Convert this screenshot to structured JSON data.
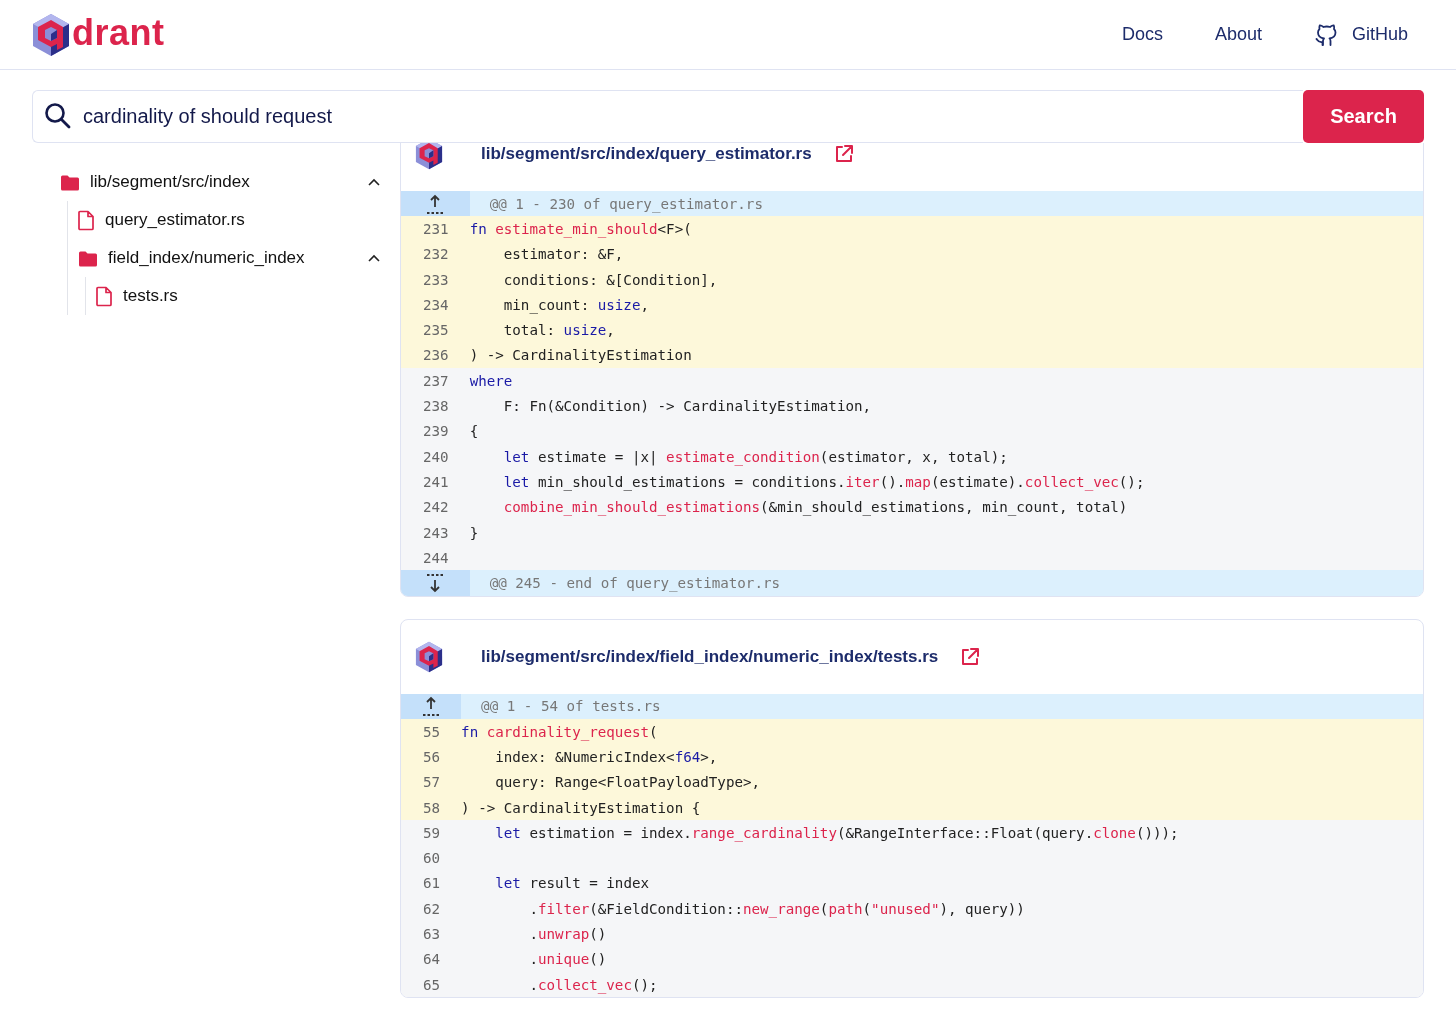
{
  "header": {
    "brand": "drant",
    "nav": [
      {
        "label": "Docs",
        "kind": "text"
      },
      {
        "label": "About",
        "kind": "text"
      },
      {
        "label": "GitHub",
        "kind": "github"
      }
    ]
  },
  "search": {
    "value": "cardinality of should request",
    "button": "Search"
  },
  "tree": [
    {
      "kind": "folder",
      "label": "lib/segment/src/index",
      "expanded": true,
      "children": [
        {
          "kind": "file",
          "label": "query_estimator.rs"
        },
        {
          "kind": "folder",
          "label": "field_index/numeric_index",
          "expanded": true,
          "children": [
            {
              "kind": "file",
              "label": "tests.rs"
            }
          ]
        }
      ]
    }
  ],
  "results": [
    {
      "path": "lib/segment/src/index/query_estimator.rs",
      "hunks": [
        {
          "kind": "expand_up",
          "text": "@@ 1 - 230 of query_estimator.rs"
        }
      ],
      "lines": [
        {
          "number": "231",
          "highlighted": true,
          "tokens": [
            {
              "kind": "keyword",
              "text": "fn"
            },
            {
              "kind": "function",
              "text": " estimate_min_should"
            },
            {
              "kind": "plain",
              "text": "<F>("
            }
          ]
        },
        {
          "number": "232",
          "highlighted": true,
          "tokens": [
            {
              "kind": "plain",
              "text": "    estimator: &F,"
            }
          ]
        },
        {
          "number": "233",
          "highlighted": true,
          "tokens": [
            {
              "kind": "plain",
              "text": "    conditions: &[Condition],"
            }
          ]
        },
        {
          "number": "234",
          "highlighted": true,
          "tokens": [
            {
              "kind": "plain",
              "text": "    min_count: "
            },
            {
              "kind": "keyword",
              "text": "usize"
            },
            {
              "kind": "plain",
              "text": ","
            }
          ]
        },
        {
          "number": "235",
          "highlighted": true,
          "tokens": [
            {
              "kind": "plain",
              "text": "    total: "
            },
            {
              "kind": "keyword",
              "text": "usize"
            },
            {
              "kind": "plain",
              "text": ","
            }
          ]
        },
        {
          "number": "236",
          "highlighted": true,
          "tokens": [
            {
              "kind": "plain",
              "text": ") -> CardinalityEstimation"
            }
          ]
        },
        {
          "number": "237",
          "highlighted": false,
          "tokens": [
            {
              "kind": "keyword",
              "text": "where"
            }
          ]
        },
        {
          "number": "238",
          "highlighted": false,
          "tokens": [
            {
              "kind": "plain",
              "text": "    F: Fn(&Condition) -> CardinalityEstimation,"
            }
          ]
        },
        {
          "number": "239",
          "highlighted": false,
          "tokens": [
            {
              "kind": "plain",
              "text": "{"
            }
          ]
        },
        {
          "number": "240",
          "highlighted": false,
          "tokens": [
            {
              "kind": "keyword",
              "text": "    let"
            },
            {
              "kind": "plain",
              "text": " estimate = |x| "
            },
            {
              "kind": "function",
              "text": "estimate_condition"
            },
            {
              "kind": "plain",
              "text": "(estimator, x, total);"
            }
          ]
        },
        {
          "number": "241",
          "highlighted": false,
          "tokens": [
            {
              "kind": "keyword",
              "text": "    let"
            },
            {
              "kind": "plain",
              "text": " min_should_estimations = conditions."
            },
            {
              "kind": "function",
              "text": "iter"
            },
            {
              "kind": "plain",
              "text": "()."
            },
            {
              "kind": "function",
              "text": "map"
            },
            {
              "kind": "plain",
              "text": "(estimate)."
            },
            {
              "kind": "function",
              "text": "collect_vec"
            },
            {
              "kind": "plain",
              "text": "();"
            }
          ]
        },
        {
          "number": "242",
          "highlighted": false,
          "tokens": [
            {
              "kind": "function",
              "text": "    combine_min_should_estimations"
            },
            {
              "kind": "plain",
              "text": "(&min_should_estimations, min_count, total)"
            }
          ]
        },
        {
          "number": "243",
          "highlighted": false,
          "tokens": [
            {
              "kind": "plain",
              "text": "}"
            }
          ]
        },
        {
          "number": "244",
          "highlighted": false
        }
      ],
      "hunks_after": [
        {
          "kind": "expand_down",
          "text": "@@ 245 - end of query_estimator.rs"
        }
      ]
    },
    {
      "path": "lib/segment/src/index/field_index/numeric_index/tests.rs",
      "hunks": [
        {
          "kind": "expand_up",
          "text": "@@ 1 - 54 of tests.rs"
        }
      ],
      "lines": [
        {
          "number": "55",
          "highlighted": true,
          "tokens": [
            {
              "kind": "keyword",
              "text": "fn"
            },
            {
              "kind": "function",
              "text": " cardinality_request"
            },
            {
              "kind": "plain",
              "text": "("
            }
          ]
        },
        {
          "number": "56",
          "highlighted": true,
          "tokens": [
            {
              "kind": "plain",
              "text": "    index: &NumericIndex<"
            },
            {
              "kind": "keyword",
              "text": "f64"
            },
            {
              "kind": "plain",
              "text": ">,"
            }
          ]
        },
        {
          "number": "57",
          "highlighted": true,
          "tokens": [
            {
              "kind": "plain",
              "text": "    query: Range<FloatPayloadType>,"
            }
          ]
        },
        {
          "number": "58",
          "highlighted": true,
          "tokens": [
            {
              "kind": "plain",
              "text": ") -> CardinalityEstimation {"
            }
          ]
        },
        {
          "number": "59",
          "highlighted": false,
          "tokens": [
            {
              "kind": "keyword",
              "text": "    let"
            },
            {
              "kind": "plain",
              "text": " estimation = index."
            },
            {
              "kind": "function",
              "text": "range_cardinality"
            },
            {
              "kind": "plain",
              "text": "(&RangeInterface::Float(query."
            },
            {
              "kind": "function",
              "text": "clone"
            },
            {
              "kind": "plain",
              "text": "()));"
            }
          ]
        },
        {
          "number": "60",
          "highlighted": false
        },
        {
          "number": "61",
          "highlighted": false,
          "tokens": [
            {
              "kind": "keyword",
              "text": "    let"
            },
            {
              "kind": "plain",
              "text": " result = index"
            }
          ]
        },
        {
          "number": "62",
          "highlighted": false,
          "tokens": [
            {
              "kind": "plain",
              "text": "        ."
            },
            {
              "kind": "function",
              "text": "filter"
            },
            {
              "kind": "plain",
              "text": "(&FieldCondition::"
            },
            {
              "kind": "function",
              "text": "new_range"
            },
            {
              "kind": "plain",
              "text": "("
            },
            {
              "kind": "function",
              "text": "path"
            },
            {
              "kind": "plain",
              "text": "("
            },
            {
              "kind": "string",
              "text": "\"unused\""
            },
            {
              "kind": "plain",
              "text": "), query))"
            }
          ]
        },
        {
          "number": "63",
          "highlighted": false,
          "tokens": [
            {
              "kind": "plain",
              "text": "        ."
            },
            {
              "kind": "function",
              "text": "unwrap"
            },
            {
              "kind": "plain",
              "text": "()"
            }
          ]
        },
        {
          "number": "64",
          "highlighted": false,
          "tokens": [
            {
              "kind": "plain",
              "text": "        ."
            },
            {
              "kind": "function",
              "text": "unique"
            },
            {
              "kind": "plain",
              "text": "()"
            }
          ]
        },
        {
          "number": "65",
          "highlighted": false,
          "tokens": [
            {
              "kind": "plain",
              "text": "        ."
            },
            {
              "kind": "function",
              "text": "collect_vec"
            },
            {
              "kind": "plain",
              "text": "();"
            }
          ]
        }
      ]
    }
  ]
}
